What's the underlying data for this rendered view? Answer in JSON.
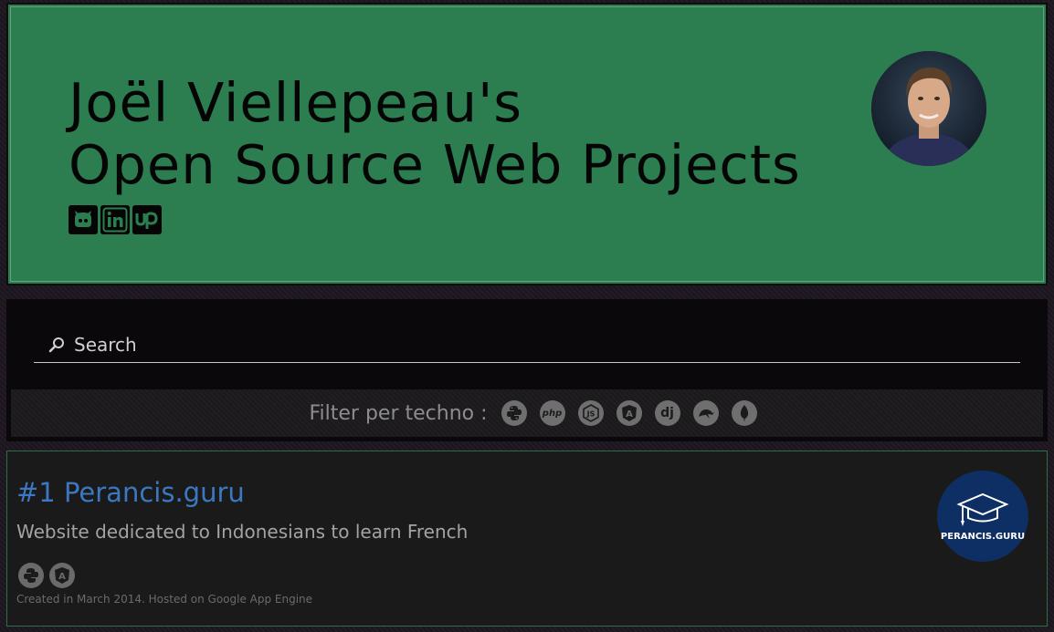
{
  "header": {
    "title_line1": "Joël Viellepeau's",
    "title_line2": "Open Source Web Projects",
    "bg_color": "#2c7d4f",
    "social_icons": [
      "github-icon",
      "linkedin-icon",
      "upwork-icon"
    ]
  },
  "search": {
    "placeholder": "Search"
  },
  "filter": {
    "label": "Filter per techno :",
    "technos": [
      {
        "icon": "python-icon",
        "text": ""
      },
      {
        "icon": "php-icon",
        "text": "php"
      },
      {
        "icon": "nodejs-icon",
        "text": "JS"
      },
      {
        "icon": "angular-icon",
        "text": "A"
      },
      {
        "icon": "django-icon",
        "text": "dj"
      },
      {
        "icon": "mysql-icon",
        "text": ""
      },
      {
        "icon": "mongodb-icon",
        "text": ""
      }
    ]
  },
  "project": {
    "title": "#1 Perancis.guru",
    "description": "Website dedicated to Indonesians to learn French",
    "meta": "Created in March 2014. Hosted on Google App Engine",
    "logo_text": "PERANCIS.GURU",
    "link_color": "#3c78c1",
    "technos": [
      "python-icon",
      "angular-icon"
    ]
  }
}
